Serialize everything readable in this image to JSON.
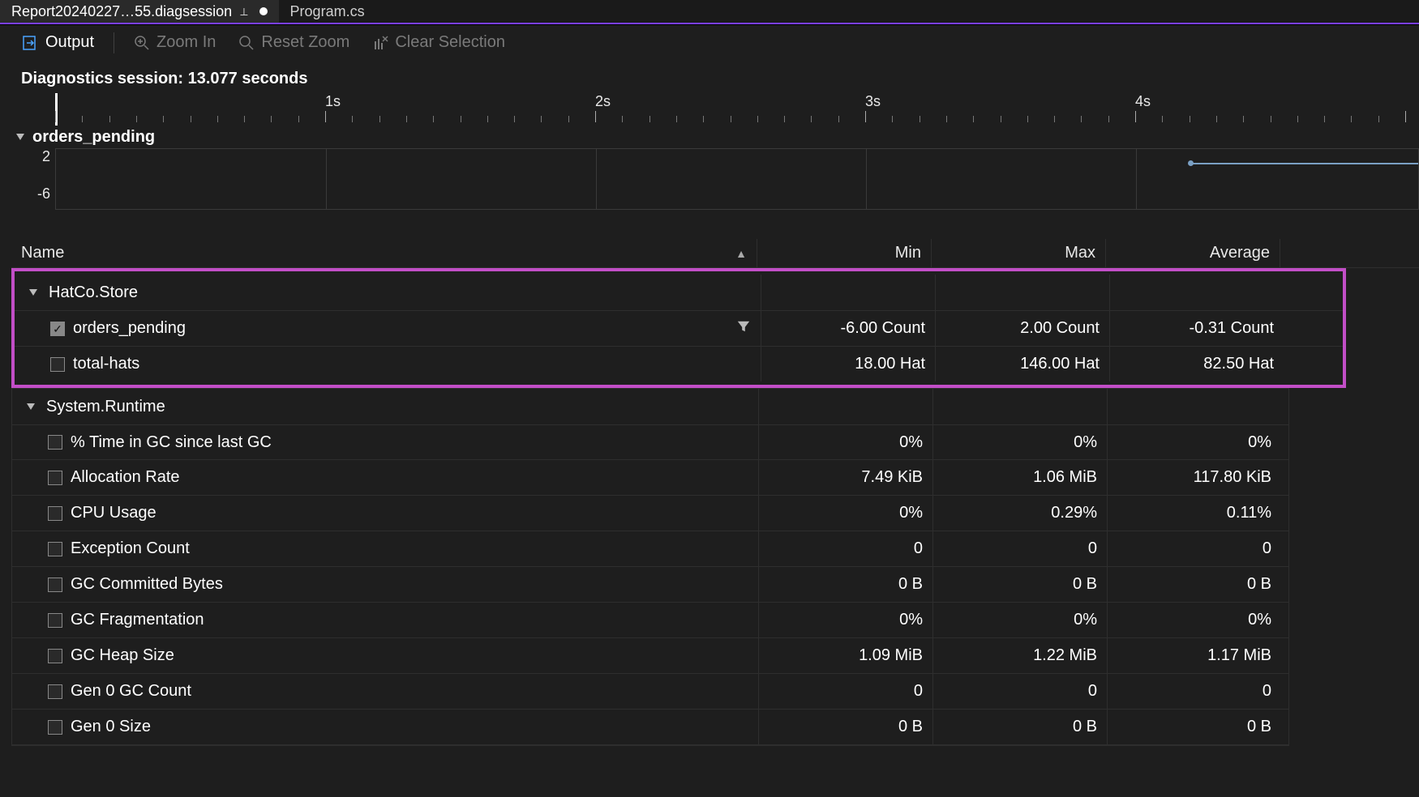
{
  "tabs": {
    "active_label": "Report20240227…55.diagsession",
    "inactive_label": "Program.cs"
  },
  "toolbar": {
    "output": "Output",
    "zoom_in": "Zoom In",
    "reset_zoom": "Reset Zoom",
    "clear_selection": "Clear Selection"
  },
  "session": {
    "label": "Diagnostics session: 13.077 seconds"
  },
  "ruler": {
    "ticks": [
      "1s",
      "2s",
      "3s",
      "4s"
    ]
  },
  "lane": {
    "title": "orders_pending",
    "y_top": "2",
    "y_bottom": "-6"
  },
  "table": {
    "headers": {
      "name": "Name",
      "min": "Min",
      "max": "Max",
      "avg": "Average"
    },
    "groups": [
      {
        "name": "HatCo.Store",
        "rows": [
          {
            "checked": true,
            "name": "orders_pending",
            "filter": true,
            "min": "-6.00 Count",
            "max": "2.00 Count",
            "avg": "-0.31 Count"
          },
          {
            "checked": false,
            "name": "total-hats",
            "filter": false,
            "min": "18.00 Hat",
            "max": "146.00 Hat",
            "avg": "82.50 Hat"
          }
        ]
      },
      {
        "name": "System.Runtime",
        "rows": [
          {
            "checked": false,
            "name": "% Time in GC since last GC",
            "min": "0%",
            "max": "0%",
            "avg": "0%"
          },
          {
            "checked": false,
            "name": "Allocation Rate",
            "min": "7.49 KiB",
            "max": "1.06 MiB",
            "avg": "117.80 KiB"
          },
          {
            "checked": false,
            "name": "CPU Usage",
            "min": "0%",
            "max": "0.29%",
            "avg": "0.11%"
          },
          {
            "checked": false,
            "name": "Exception Count",
            "min": "0",
            "max": "0",
            "avg": "0"
          },
          {
            "checked": false,
            "name": "GC Committed Bytes",
            "min": "0 B",
            "max": "0 B",
            "avg": "0 B"
          },
          {
            "checked": false,
            "name": "GC Fragmentation",
            "min": "0%",
            "max": "0%",
            "avg": "0%"
          },
          {
            "checked": false,
            "name": "GC Heap Size",
            "min": "1.09 MiB",
            "max": "1.22 MiB",
            "avg": "1.17 MiB"
          },
          {
            "checked": false,
            "name": "Gen 0 GC Count",
            "min": "0",
            "max": "0",
            "avg": "0"
          },
          {
            "checked": false,
            "name": "Gen 0 Size",
            "min": "0 B",
            "max": "0 B",
            "avg": "0 B"
          }
        ]
      }
    ]
  },
  "chart_data": {
    "type": "line",
    "title": "orders_pending",
    "xlabel": "seconds",
    "ylabel": "Count",
    "ylim": [
      -6,
      2
    ],
    "xlim": [
      0,
      5
    ],
    "series": [
      {
        "name": "orders_pending",
        "x": [
          4.25,
          5.0
        ],
        "y": [
          2,
          2
        ]
      }
    ]
  }
}
